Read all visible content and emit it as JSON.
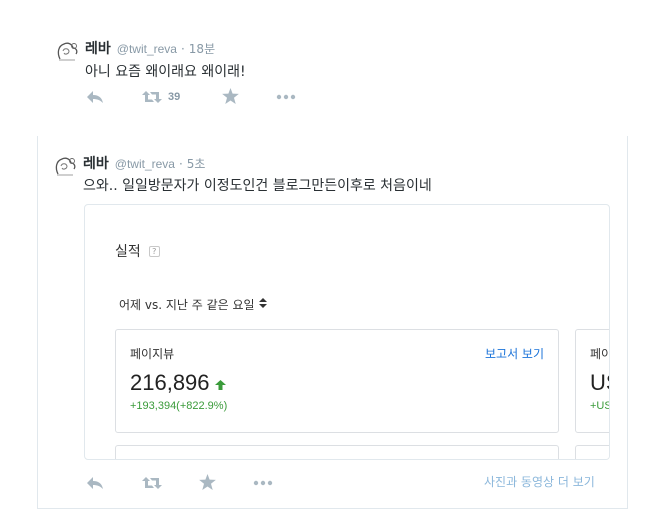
{
  "tweets": [
    {
      "fullname": "레바",
      "username": "@twit_reva",
      "separator": "·",
      "time": "18분",
      "text": "아니 요즘 왜이래요 왜이래!",
      "retweet_count": "39"
    },
    {
      "fullname": "레바",
      "username": "@twit_reva",
      "separator": "·",
      "time": "5초",
      "text": "으와.. 일일방문자가 이정도인건 블로그만든이후로 처음이네",
      "retweet_count": "",
      "view_media_label": "사진과 동영상 더 보기",
      "media": {
        "title": "실적",
        "help": "?",
        "compare_label": "어제 vs. 지난 주 같은 요일",
        "sort_icon": "sort-icon",
        "cards": [
          {
            "label": "페이지뷰",
            "link": "보고서 보기",
            "value": "216,896",
            "trend_icon": "up-arrow-icon",
            "change": "+193,394(+822.9%)"
          },
          {
            "label": "페이",
            "value": "US",
            "change": "+US"
          }
        ]
      }
    }
  ],
  "colors": {
    "text": "#292f33",
    "meta": "#8899a6",
    "action_icon": "#aab8c2",
    "link": "#1b73d9",
    "positive": "#3a9b3a",
    "view_media": "#8bb7db"
  }
}
